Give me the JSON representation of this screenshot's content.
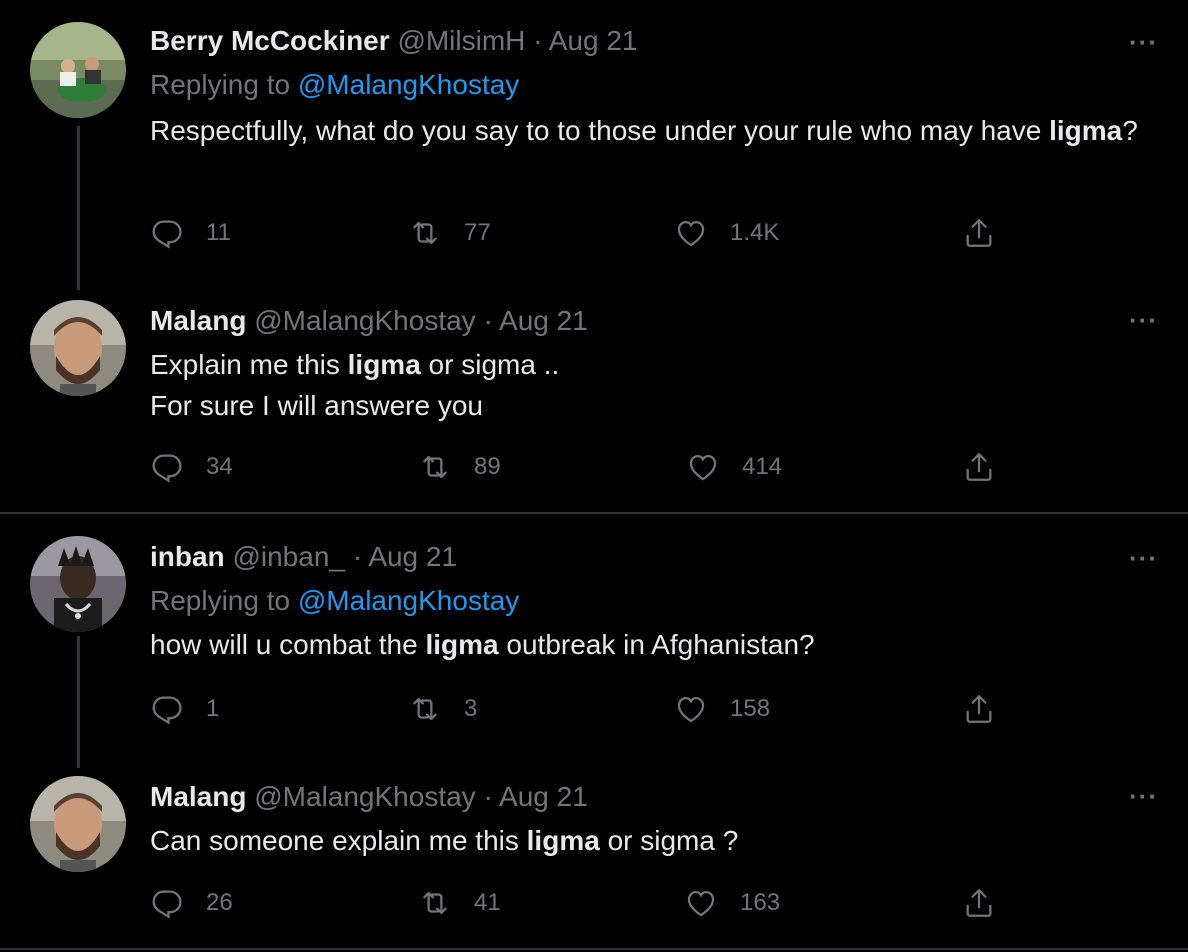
{
  "tweets": [
    {
      "name": "Berry McCockiner",
      "handle": "@MilsimH",
      "sep": "·",
      "date": "Aug 21",
      "replying_label": "Replying to",
      "replying_to": "@MalangKhostay",
      "text_parts": [
        "Respectfully, what do you say to to those under your rule who may have ",
        "ligma",
        "?"
      ],
      "replies": "11",
      "retweets": "77",
      "likes": "1.4K",
      "more": "···"
    },
    {
      "name": "Malang",
      "handle": "@MalangKhostay",
      "sep": "·",
      "date": "Aug 21",
      "text_line1_parts": [
        "Explain me this ",
        "ligma",
        " or sigma .."
      ],
      "text_line2": "For sure I will answere you",
      "replies": "34",
      "retweets": "89",
      "likes": "414",
      "more": "···"
    },
    {
      "name": "inban",
      "handle": "@inban_",
      "sep": "·",
      "date": "Aug 21",
      "replying_label": "Replying to",
      "replying_to": "@MalangKhostay",
      "text_parts": [
        "how will u combat the ",
        "ligma",
        " outbreak in Afghanistan?"
      ],
      "replies": "1",
      "retweets": "3",
      "likes": "158",
      "more": "···"
    },
    {
      "name": "Malang",
      "handle": "@MalangKhostay",
      "sep": "·",
      "date": "Aug 21",
      "text_parts": [
        "Can someone explain me this ",
        "ligma",
        " or sigma ?"
      ],
      "replies": "26",
      "retweets": "41",
      "likes": "163",
      "more": "···"
    }
  ],
  "icons": {
    "reply": "reply-icon",
    "retweet": "retweet-icon",
    "like": "heart-icon",
    "share": "share-icon",
    "more": "more-icon"
  },
  "colors": {
    "background": "#000000",
    "text": "#e7e9ea",
    "muted": "#71767b",
    "link": "#1d9bf0",
    "divider": "#2f3336"
  }
}
